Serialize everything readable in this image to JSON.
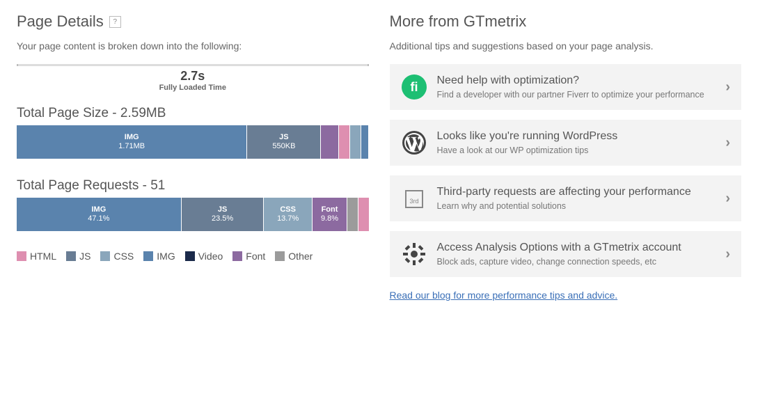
{
  "left": {
    "title": "Page Details",
    "subtitle": "Your page content is broken down into the following:",
    "timeline": {
      "time": "2.7s",
      "name": "Fully Loaded Time"
    },
    "pagesize": {
      "title": "Total Page Size - 2.59MB",
      "segments": [
        {
          "label": "IMG",
          "value": "1.71MB",
          "color": "#5a83ad",
          "pct": 66
        },
        {
          "label": "JS",
          "value": "550KB",
          "color": "#697d94",
          "pct": 21
        },
        {
          "label": "",
          "value": "",
          "color": "#8c6aa0",
          "pct": 5
        },
        {
          "label": "",
          "value": "",
          "color": "#de8fb0",
          "pct": 3
        },
        {
          "label": "",
          "value": "",
          "color": "#8aa6bb",
          "pct": 3
        },
        {
          "label": "",
          "value": "",
          "color": "#5a83ad",
          "pct": 2
        }
      ]
    },
    "requests": {
      "title": "Total Page Requests - 51",
      "segments": [
        {
          "label": "IMG",
          "value": "47.1%",
          "color": "#5a83ad",
          "pct": 47.1
        },
        {
          "label": "JS",
          "value": "23.5%",
          "color": "#697d94",
          "pct": 23.5
        },
        {
          "label": "CSS",
          "value": "13.7%",
          "color": "#8aa6bb",
          "pct": 13.7
        },
        {
          "label": "Font",
          "value": "9.8%",
          "color": "#8c6aa0",
          "pct": 9.8
        },
        {
          "label": "",
          "value": "",
          "color": "#9b9b9b",
          "pct": 3
        },
        {
          "label": "",
          "value": "",
          "color": "#de8fb0",
          "pct": 2.9
        }
      ]
    },
    "legend": [
      {
        "label": "HTML",
        "class": "c-html"
      },
      {
        "label": "JS",
        "class": "c-js"
      },
      {
        "label": "CSS",
        "class": "c-css"
      },
      {
        "label": "IMG",
        "class": "c-img"
      },
      {
        "label": "Video",
        "class": "c-video"
      },
      {
        "label": "Font",
        "class": "c-font"
      },
      {
        "label": "Other",
        "class": "c-other"
      }
    ]
  },
  "right": {
    "title": "More from GTmetrix",
    "subtitle": "Additional tips and suggestions based on your page analysis.",
    "tips": [
      {
        "icon": "fiverr",
        "title": "Need help with optimization?",
        "desc": "Find a developer with our partner Fiverr to optimize your performance"
      },
      {
        "icon": "wordpress",
        "title": "Looks like you're running WordPress",
        "desc": "Have a look at our WP optimization tips"
      },
      {
        "icon": "thirdparty",
        "title": "Third-party requests are affecting your performance",
        "desc": "Learn why and potential solutions"
      },
      {
        "icon": "gear",
        "title": "Access Analysis Options with a GTmetrix account",
        "desc": "Block ads, capture video, change connection speeds, etc"
      }
    ],
    "blog_link": "Read our blog for more performance tips and advice."
  },
  "chart_data": [
    {
      "type": "bar",
      "title": "Total Page Size - 2.59MB",
      "orientation": "stacked-horizontal",
      "categories": [
        "IMG",
        "JS",
        "Font",
        "HTML",
        "CSS",
        "Other"
      ],
      "labels_shown": [
        "IMG 1.71MB",
        "JS 550KB"
      ],
      "values_bytes": [
        1710000,
        550000,
        130000,
        80000,
        75000,
        50000
      ],
      "total": "2.59MB"
    },
    {
      "type": "bar",
      "title": "Total Page Requests - 51",
      "orientation": "stacked-horizontal",
      "categories": [
        "IMG",
        "JS",
        "CSS",
        "Font",
        "Other",
        "HTML"
      ],
      "values_pct": [
        47.1,
        23.5,
        13.7,
        9.8,
        3.0,
        2.9
      ],
      "total": 51
    }
  ]
}
